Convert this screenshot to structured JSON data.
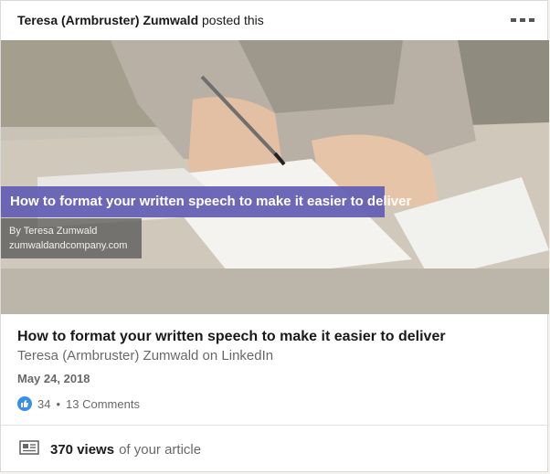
{
  "header": {
    "author": "Teresa (Armbruster) Zumwald",
    "action": "posted this",
    "more_icon": "ellipsis-icon"
  },
  "hero": {
    "overlay_title": "How to format your written speech to make it easier to deliver",
    "overlay_byline": "By Teresa Zumwald",
    "overlay_domain": "zumwaldandcompany.com"
  },
  "article": {
    "title": "How to format your written speech to make it easier to deliver",
    "subtitle": "Teresa (Armbruster) Zumwald on LinkedIn",
    "date": "May 24, 2018"
  },
  "social": {
    "reaction_icon": "like-icon",
    "reaction_count": "34",
    "separator": "•",
    "comments": "13 Comments"
  },
  "stats": {
    "icon": "article-icon",
    "views": "370 views",
    "suffix": "of your article"
  },
  "colors": {
    "overlay_accent": "#625cb4",
    "like_blue": "#378fe9"
  }
}
